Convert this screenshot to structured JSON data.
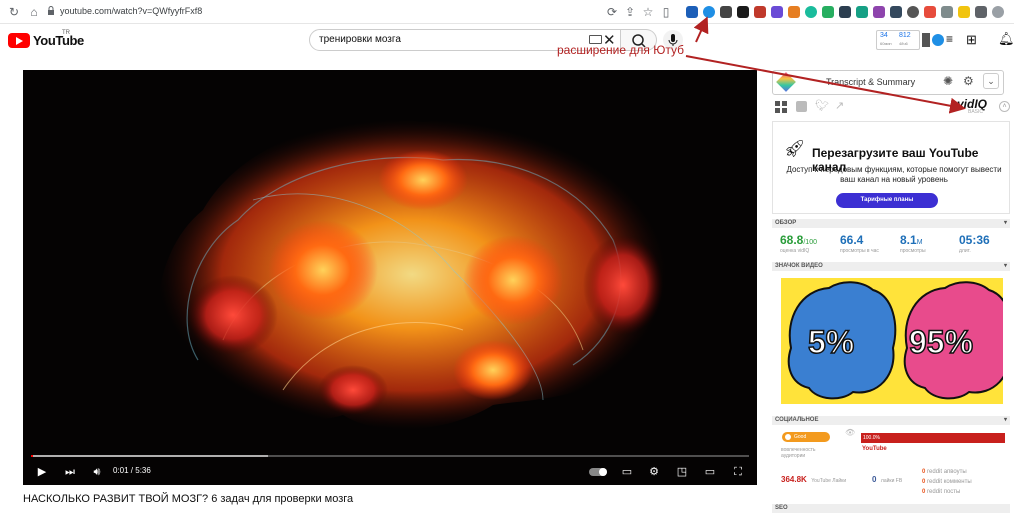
{
  "browser": {
    "url": "youtube.com/watch?v=QWfyyfrFxf8"
  },
  "header": {
    "logo_text": "YouTube",
    "country_code": "TR",
    "search_query": "тренировки мозга",
    "counter_top_left": "34",
    "counter_top_right": "812",
    "counter_bottom_left": "60мин",
    "counter_bottom_right": "48ч6"
  },
  "annotation": {
    "caption": "расширение для Ютуб"
  },
  "player": {
    "time_display": "0:01 / 5:36",
    "progress_fraction": 0.003,
    "buffer_fraction": 0.33
  },
  "video": {
    "title": "НАСКОЛЬКО РАЗВИТ ТВОЙ МОЗГ? 6 задач для проверки мозга"
  },
  "sidebar": {
    "transcript_label": "Transcript & Summary",
    "vidiq_logo": "vidIQ",
    "vidiq_tier": "BASIC",
    "promo_title": "Перезагрузите ваш YouTube канал",
    "promo_desc": "Доступ к передовым функциям, которые помогут вывести ваш канал на новый уровень",
    "promo_button": "Тарифные планы",
    "overview_header": "ОБЗОР",
    "stats": [
      {
        "value": "68.8",
        "unit": "/100",
        "label": "оценка vidIQ",
        "color": "#2a9d3a"
      },
      {
        "value": "66.4",
        "unit": "",
        "label": "просмотры в час",
        "color": "#1e6fb8"
      },
      {
        "value": "8.1",
        "unit": "M",
        "label": "просмотры",
        "color": "#1e6fb8"
      },
      {
        "value": "05:36",
        "unit": "",
        "label": "длит.",
        "color": "#1e6fb8"
      }
    ],
    "thumbnail_header": "ЗНАЧОК ВИДЕО",
    "thumb_left_text": "5%",
    "thumb_right_text": "95%",
    "social_header": "СОЦИАЛЬНОЕ",
    "social_pill": "Good",
    "social_sub": "вовлеченность аудитории",
    "social_percent": "100.0%",
    "social_percent_value": 1.0,
    "social_platform": "YouTube",
    "likes_value": "364.8K",
    "likes_label": "YouTube Лайки",
    "fb_value": "0",
    "fb_label": "лайки FB",
    "reddit": [
      {
        "value": "0",
        "label": "reddit апвоуты"
      },
      {
        "value": "0",
        "label": "reddit комменты"
      },
      {
        "value": "0",
        "label": "reddit посты"
      }
    ],
    "seo_header": "SEO"
  },
  "colors": {
    "brand_red": "#ff0000",
    "vidiq_purple": "#3c2fd3",
    "annotation_red": "#b22222"
  }
}
